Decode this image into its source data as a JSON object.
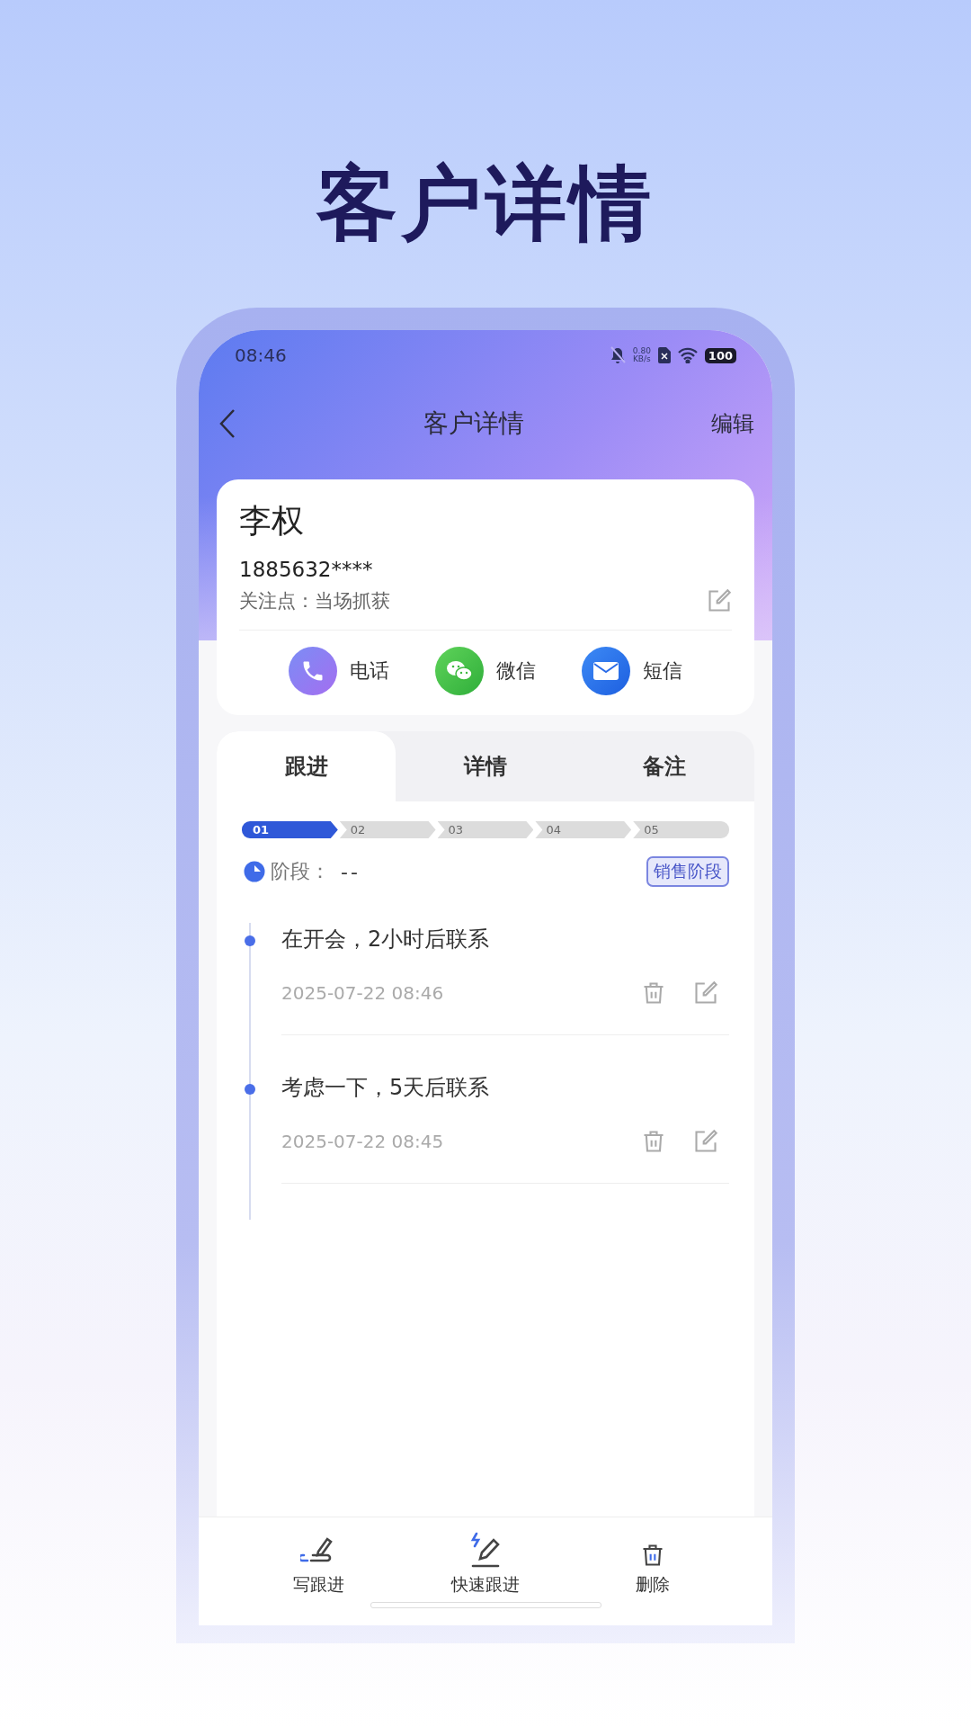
{
  "headline": "客户详情",
  "status_bar": {
    "time": "08:46",
    "net_speed": "0.80",
    "net_unit": "KB/s",
    "battery": "100"
  },
  "nav": {
    "title": "客户详情",
    "action": "编辑"
  },
  "customer": {
    "name": "李权",
    "phone": "1885632****",
    "focus_label": "关注点：",
    "focus_value": "当场抓获"
  },
  "contact_actions": [
    {
      "kind": "phone",
      "label": "电话"
    },
    {
      "kind": "wechat",
      "label": "微信"
    },
    {
      "kind": "sms",
      "label": "短信"
    }
  ],
  "tabs": [
    {
      "label": "跟进",
      "selected": true
    },
    {
      "label": "详情",
      "selected": false
    },
    {
      "label": "备注",
      "selected": false
    }
  ],
  "steps": [
    {
      "label": "01",
      "selected": true
    },
    {
      "label": "02",
      "selected": false
    },
    {
      "label": "03",
      "selected": false
    },
    {
      "label": "04",
      "selected": false
    },
    {
      "label": "05",
      "selected": false
    }
  ],
  "stage": {
    "label": "阶段：",
    "value": "--",
    "button": "销售阶段"
  },
  "followups": [
    {
      "text": "在开会，2小时后联系",
      "time": "2025-07-22 08:46"
    },
    {
      "text": "考虑一下，5天后联系",
      "time": "2025-07-22 08:45"
    }
  ],
  "bottom_bar": [
    {
      "kind": "write",
      "label": "写跟进"
    },
    {
      "kind": "quick",
      "label": "快速跟进"
    },
    {
      "kind": "delete",
      "label": "删除"
    }
  ]
}
